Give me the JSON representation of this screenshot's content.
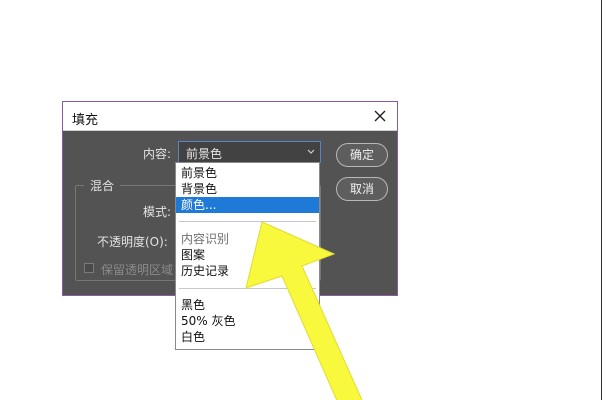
{
  "dialog": {
    "title": "填充",
    "content_label": "内容:",
    "content_value": "前景色",
    "ok_label": "确定",
    "cancel_label": "取消",
    "blend_group_title": "混合",
    "mode_label": "模式:",
    "opacity_label": "不透明度(O):",
    "preserve_label": "保留透明区域"
  },
  "dropdown": {
    "items": [
      "前景色",
      "背景色",
      "颜色...",
      "内容识别",
      "图案",
      "历史记录",
      "黑色",
      "50% 灰色",
      "白色"
    ],
    "selected_index": 2
  },
  "colors": {
    "dialog_bg": "#535353",
    "title_bg": "#ffffff",
    "selection": "#1e7ad6",
    "arrow": "#f8f83c"
  }
}
